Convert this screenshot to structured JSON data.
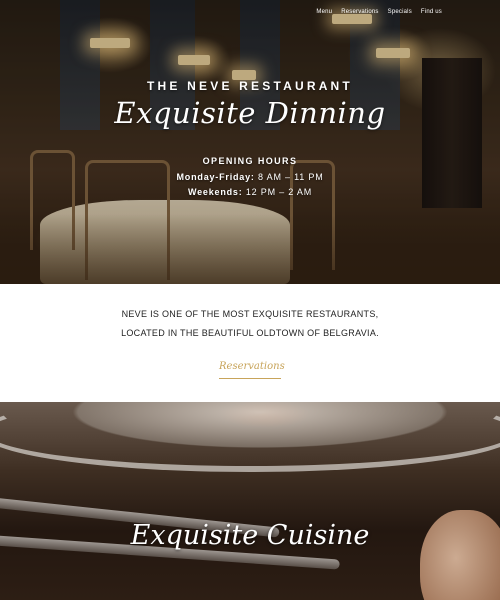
{
  "nav": {
    "items": [
      "Menu",
      "Reservations",
      "Specials",
      "Find us"
    ]
  },
  "hero": {
    "title": "THE NEVE RESTAURANT",
    "script_title": "Exquisite Dinning",
    "hours_heading": "OPENING HOURS",
    "weekday_label": "Monday-Friday:",
    "weekday_hours": "8 AM – 11 PM",
    "weekend_label": "Weekends:",
    "weekend_hours": "12 PM – 2 AM"
  },
  "about": {
    "line1": "NEVE IS ONE OF THE MOST EXQUISITE RESTAURANTS,",
    "line2": "LOCATED IN THE BEAUTIFUL OLDTOWN OF BELGRAVIA.",
    "button_label": "Reservations"
  },
  "cuisine": {
    "title": "Exquisite Cuisine"
  },
  "colors": {
    "accent_gold": "#c8a45a",
    "text_dark": "#222222",
    "hero_text": "#ffffff"
  }
}
